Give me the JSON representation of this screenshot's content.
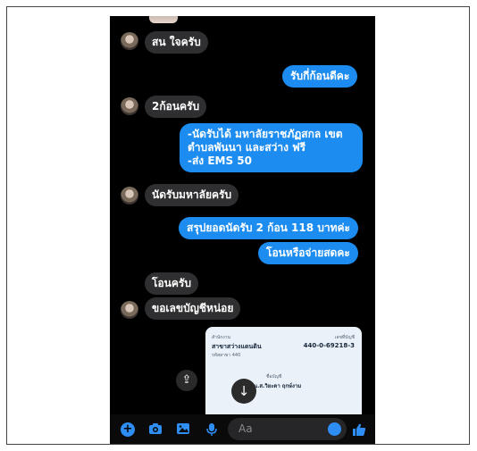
{
  "messages": [
    {
      "text": "สน ใจครับ"
    },
    {
      "text": "รับกี่ก้อนดีคะ"
    },
    {
      "text": "2ก้อนครับ"
    },
    {
      "text": "-นัดรับได้ มหาลัยราชภัฏสกล เขต\nตำบลพันนา และสว่าง ฟรี\n-ส่ง EMS 50"
    },
    {
      "text": "นัดรับมหาลัยครับ"
    },
    {
      "text": "สรุปยอดนัดรับ 2 ก้อน 118 บาทค่ะ"
    },
    {
      "text": "โอนหรือจ่ายสดคะ"
    },
    {
      "text": "โอนครับ"
    },
    {
      "text": "ขอเลขบัญชีหน่อย"
    }
  ],
  "bank_card": {
    "branch_label": "สำนักงาน",
    "branch_name": "สาขาสว่างแดนดิน",
    "branch_code": "รหัสสาขา 440",
    "account_label": "เลขที่บัญชี",
    "account_number": "440-0-69218-3",
    "name_label": "ชื่อบัญชี",
    "account_name": "น.ส.วิยะดา ฤกษ์งาม"
  },
  "composer": {
    "placeholder": "Aa"
  },
  "icons": {
    "download": "download-icon",
    "share": "share-icon",
    "plus": "plus-icon",
    "camera": "camera-icon",
    "gallery": "gallery-icon",
    "mic": "microphone-icon",
    "emoji": "emoji-icon",
    "like": "thumbs-up-icon"
  },
  "colors": {
    "outgoing": "#1d8cf0",
    "incoming": "#2f2f31",
    "background": "#000000",
    "accent": "#2e8ef5"
  }
}
